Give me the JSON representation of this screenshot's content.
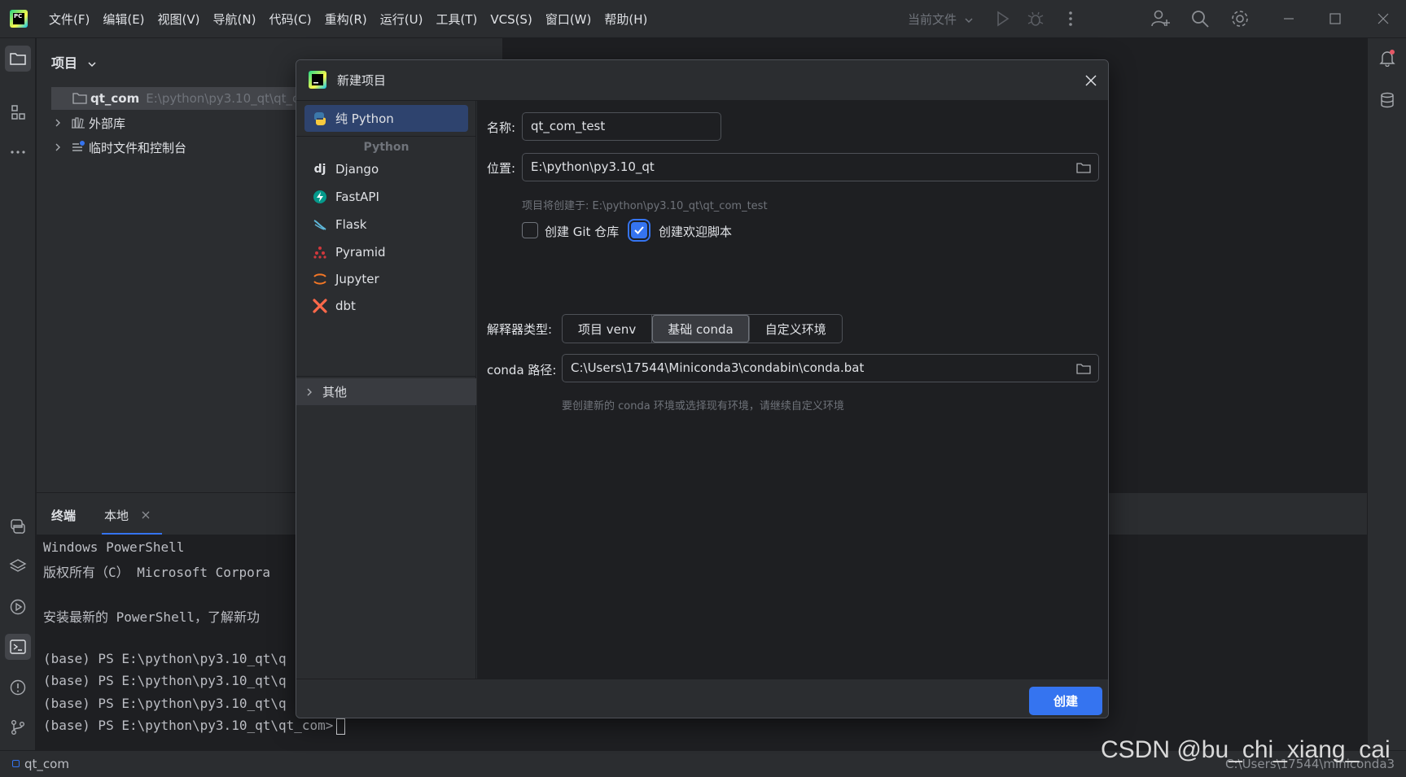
{
  "app": {
    "logo_text": "PC",
    "menu": [
      "文件(F)",
      "编辑(E)",
      "视图(V)",
      "导航(N)",
      "代码(C)",
      "重构(R)",
      "运行(U)",
      "工具(T)",
      "VCS(S)",
      "窗口(W)",
      "帮助(H)"
    ],
    "current_file": "当前文件"
  },
  "project_panel": {
    "title": "项目",
    "root_name": "qt_com",
    "root_path": "E:\\python\\py3.10_qt\\qt_c",
    "external_libs": "外部库",
    "scratches": "临时文件和控制台"
  },
  "terminal": {
    "tab_title": "终端",
    "tab_local": "本地",
    "lines": [
      "Windows PowerShell",
      "版权所有（C） Microsoft Corpora",
      "",
      "安装最新的 PowerShell，了解新功",
      "",
      "(base) PS E:\\python\\py3.10_qt\\q",
      "(base) PS E:\\python\\py3.10_qt\\q",
      "(base) PS E:\\python\\py3.10_qt\\q",
      "(base) PS E:\\python\\py3.10_qt\\qt_com>"
    ]
  },
  "statusbar": {
    "project": "qt_com",
    "right_path": "C:\\Users\\17544\\miniconda3"
  },
  "dialog": {
    "title": "新建项目",
    "generators": {
      "pure_python": "纯 Python",
      "group_label": "Python",
      "django": "Django",
      "fastapi": "FastAPI",
      "flask": "Flask",
      "pyramid": "Pyramid",
      "jupyter": "Jupyter",
      "dbt": "dbt",
      "other": "其他"
    },
    "form": {
      "name_label": "名称:",
      "name_value": "qt_com_test",
      "location_label": "位置:",
      "location_value": "E:\\python\\py3.10_qt",
      "location_hint": "项目将创建于: E:\\python\\py3.10_qt\\qt_com_test",
      "git_label": "创建 Git 仓库",
      "git_checked": false,
      "welcome_label": "创建欢迎脚本",
      "welcome_checked": true,
      "interpreter_label": "解释器类型:",
      "interpreter_options": [
        "项目 venv",
        "基础 conda",
        "自定义环境"
      ],
      "interpreter_selected": "基础 conda",
      "conda_label": "conda 路径:",
      "conda_value": "C:\\Users\\17544\\Miniconda3\\condabin\\conda.bat",
      "conda_hint": "要创建新的 conda 环境或选择现有环境，请继续自定义环境"
    },
    "create_button": "创建"
  },
  "watermark": "CSDN @bu_chi_xiang_cai",
  "colors": {
    "accent": "#3574f0",
    "panel_bg": "#2b2d30",
    "editor_bg": "#1e1f22",
    "selection": "#2e436e"
  }
}
